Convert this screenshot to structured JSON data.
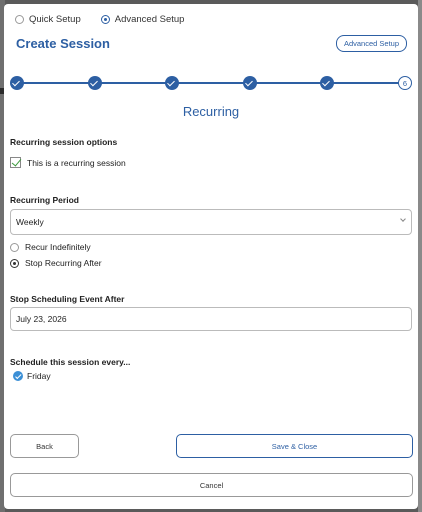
{
  "mode": {
    "quick_label": "Quick Setup",
    "advanced_label": "Advanced Setup",
    "selected": "advanced"
  },
  "header": {
    "title": "Create Session",
    "advanced_button": "Advanced Setup"
  },
  "stepper": {
    "total_steps": 6,
    "current_step": 6,
    "current_label": "6"
  },
  "section": {
    "title": "Recurring"
  },
  "recurring": {
    "options_label": "Recurring session options",
    "is_recurring_label": "This is a recurring session",
    "is_recurring_checked": true,
    "period_label": "Recurring Period",
    "period_value": "Weekly",
    "recur_indefinitely_label": "Recur Indefinitely",
    "stop_recurring_after_label": "Stop Recurring After",
    "end_mode": "stop_after",
    "stop_after_label": "Stop Scheduling Event After",
    "stop_after_value": "July 23, 2026",
    "schedule_every_label": "Schedule this session every...",
    "days": [
      "Friday"
    ]
  },
  "footer": {
    "back_label": "Back",
    "save_label": "Save & Close",
    "cancel_label": "Cancel"
  },
  "colors": {
    "accent": "#2d5fa3",
    "check_green": "#3c9a3c",
    "day_check": "#3b8fd6"
  }
}
